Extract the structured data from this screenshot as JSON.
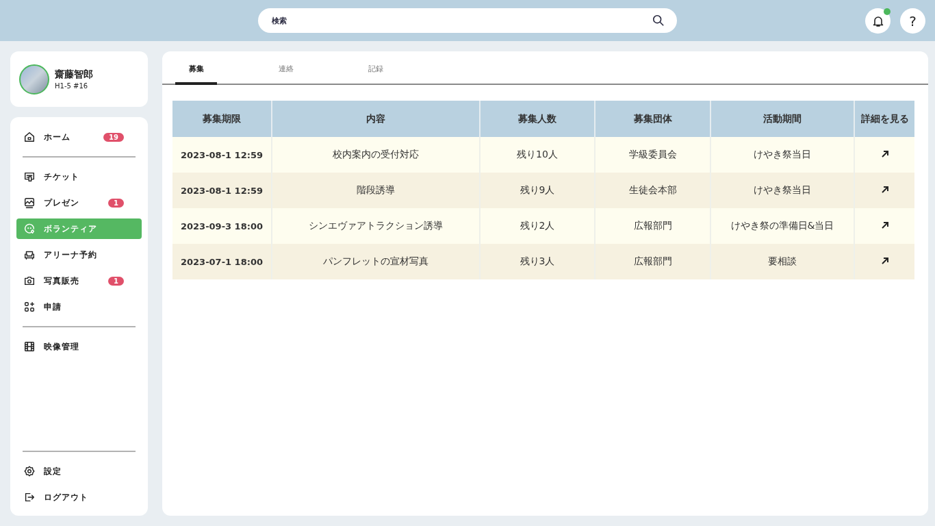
{
  "search": {
    "placeholder": "検索"
  },
  "header": {
    "notification_unread": true,
    "help_label": "?"
  },
  "profile": {
    "name": "齋藤智郎",
    "class_id": "H1-5 #16"
  },
  "nav_sections": [
    [
      {
        "label": "ホーム",
        "badge": "19",
        "selected": false
      }
    ],
    [
      {
        "label": "チケット",
        "selected": false
      },
      {
        "label": "プレゼン",
        "badge": "1",
        "selected": false
      },
      {
        "label": "ボランティア",
        "selected": true
      },
      {
        "label": "アリーナ予約",
        "selected": false
      },
      {
        "label": "写真販売",
        "badge": "1",
        "selected": false
      },
      {
        "label": "申請",
        "selected": false
      }
    ],
    [
      {
        "label": "映像管理",
        "selected": false
      }
    ]
  ],
  "nav_bottom": [
    {
      "label": "設定",
      "selected": false
    },
    {
      "label": "ログアウト",
      "selected": false
    }
  ],
  "tabs": [
    {
      "label": "募集",
      "selected": true
    },
    {
      "label": "連絡",
      "selected": false
    },
    {
      "label": "記録",
      "selected": false
    }
  ],
  "table": {
    "columns": [
      "募集期限",
      "内容",
      "募集人数",
      "募集団体",
      "活動期間",
      "詳細を見る"
    ],
    "rows": [
      [
        "2023-08-1 12:59",
        "校内案内の受付対応",
        "残り10人",
        "学級委員会",
        "けやき祭当日"
      ],
      [
        "2023-08-1 12:59",
        "階段誘導",
        "残り9人",
        "生徒会本部",
        "けやき祭当日"
      ],
      [
        "2023-09-3 18:00",
        "シンエヴァアトラクション誘導",
        "残り2人",
        "広報部門",
        "けやき祭の準備日&当日"
      ],
      [
        "2023-07-1 18:00",
        "パンフレットの宣材写真",
        "残り3人",
        "広報部門",
        "要相談"
      ]
    ]
  }
}
